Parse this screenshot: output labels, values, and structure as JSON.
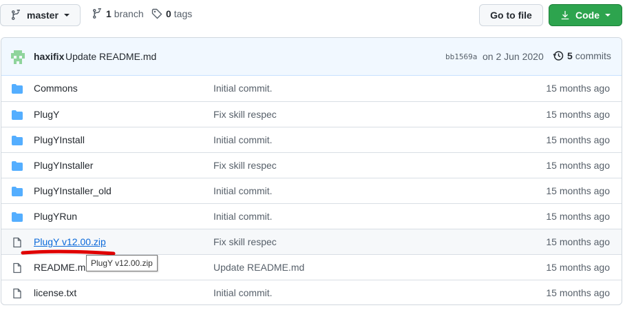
{
  "topbar": {
    "branch_label": "master",
    "branch_count": "1",
    "branch_text": "branch",
    "tag_count": "0",
    "tag_text": "tags",
    "goto_label": "Go to file",
    "code_label": "Code"
  },
  "commit": {
    "author": "haxifix",
    "message": "Update README.md",
    "sha": "bb1569a",
    "date": "on 2 Jun 2020",
    "count": "5",
    "count_text": "commits"
  },
  "files": [
    {
      "type": "folder",
      "name": "Commons",
      "message": "Initial commit.",
      "age": "15 months ago"
    },
    {
      "type": "folder",
      "name": "PlugY",
      "message": "Fix skill respec",
      "age": "15 months ago"
    },
    {
      "type": "folder",
      "name": "PlugYInstall",
      "message": "Initial commit.",
      "age": "15 months ago"
    },
    {
      "type": "folder",
      "name": "PlugYInstaller",
      "message": "Fix skill respec",
      "age": "15 months ago"
    },
    {
      "type": "folder",
      "name": "PlugYInstaller_old",
      "message": "Initial commit.",
      "age": "15 months ago"
    },
    {
      "type": "folder",
      "name": "PlugYRun",
      "message": "Initial commit.",
      "age": "15 months ago"
    },
    {
      "type": "file",
      "name": "PlugY v12.00.zip",
      "message": "Fix skill respec",
      "age": "15 months ago"
    },
    {
      "type": "file",
      "name": "README.md",
      "message": "Update README.md",
      "age": "15 months ago"
    },
    {
      "type": "file",
      "name": "license.txt",
      "message": "Initial commit.",
      "age": "15 months ago"
    }
  ],
  "tooltip": "PlugY v12.00.zip",
  "icons": {
    "branch": "git-branch-icon",
    "tag": "tag-icon",
    "folder": "folder-icon",
    "file": "file-icon",
    "history": "history-icon",
    "download": "download-icon"
  },
  "colors": {
    "folder": "#54aeff",
    "link": "#0969da",
    "code_button": "#2da44e",
    "commit_bar": "#f1f8ff",
    "annotation": "#e00000"
  }
}
